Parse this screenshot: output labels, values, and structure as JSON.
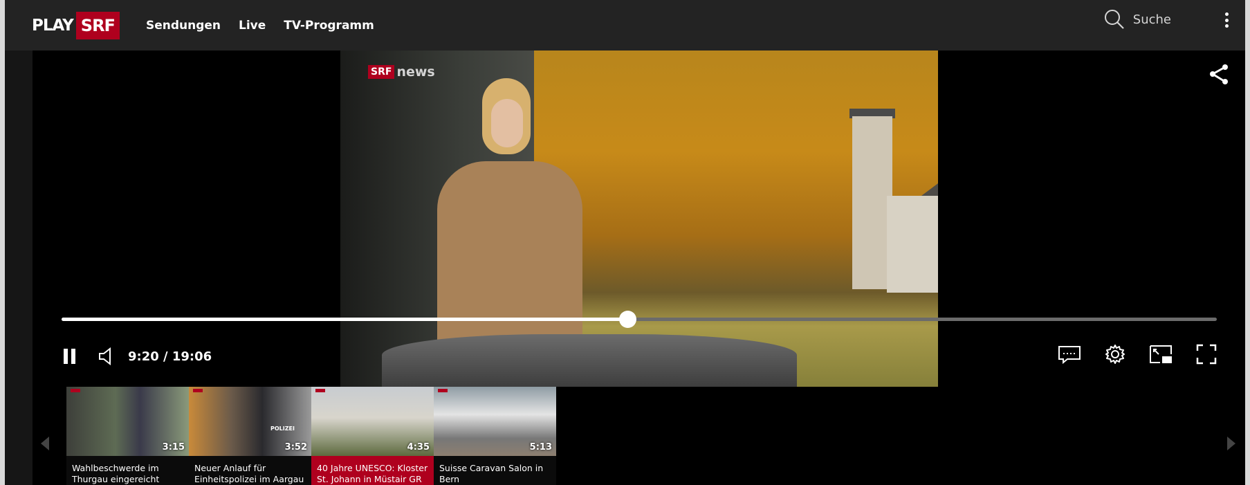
{
  "header": {
    "logo_play": "PLAY",
    "logo_srf": "SRF",
    "nav": [
      "Sendungen",
      "Live",
      "TV-Programm"
    ],
    "search_label": "Suche"
  },
  "player": {
    "watermark_box": "SRF",
    "watermark_text": "news",
    "time": "9:20 / 19:06",
    "progress_fraction": 0.49,
    "icons": {
      "share": "share-icon",
      "pause": "pause-icon",
      "volume": "volume-icon",
      "subtitles": "subtitles-icon",
      "settings": "gear-icon",
      "pip": "picture-in-picture-icon",
      "fullscreen": "fullscreen-icon"
    }
  },
  "playlist": {
    "items": [
      {
        "duration": "3:15",
        "title": "Wahlbeschwerde im Thurgau eingereicht"
      },
      {
        "duration": "3:52",
        "title": "Neuer Anlauf für Einheitspolizei im Aargau"
      },
      {
        "duration": "4:35",
        "title": "40 Jahre UNESCO: Kloster St. Johann in Müstair GR"
      },
      {
        "duration": "5:13",
        "title": "Suisse Caravan Salon in Bern"
      }
    ],
    "thumb_badge_text": "POLIZEI"
  },
  "colors": {
    "brand_red": "#af001e",
    "topbar": "#232323",
    "player_bg": "#000000"
  }
}
